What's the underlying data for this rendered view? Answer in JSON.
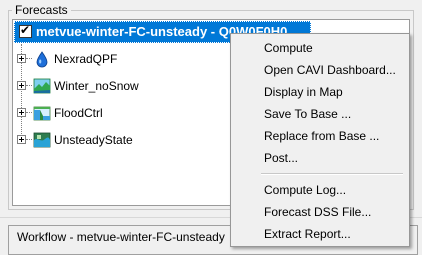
{
  "panel": {
    "group_title": "Forecasts"
  },
  "tree": {
    "root": {
      "label": "metvue-winter-FC-unsteady - Q0W0F0H0",
      "checked": true
    },
    "nodes": [
      {
        "label": "NexradQPF",
        "icon": "water-drop-icon"
      },
      {
        "label": "Winter_noSnow",
        "icon": "landscape-icon"
      },
      {
        "label": "FloodCtrl",
        "icon": "reservoir-icon"
      },
      {
        "label": "UnsteadyState",
        "icon": "hydraulic-model-icon"
      }
    ]
  },
  "workflow": {
    "label": "Workflow - metvue-winter-FC-unsteady"
  },
  "context_menu": {
    "items": [
      "Compute",
      "Open CAVI Dashboard...",
      "Display in Map",
      "Save To Base ...",
      "Replace from Base ...",
      "Post...",
      "Compute Log...",
      "Forecast DSS File...",
      "Extract Report..."
    ]
  },
  "colors": {
    "selection": "#0078d7",
    "background": "#f0f0f0"
  }
}
